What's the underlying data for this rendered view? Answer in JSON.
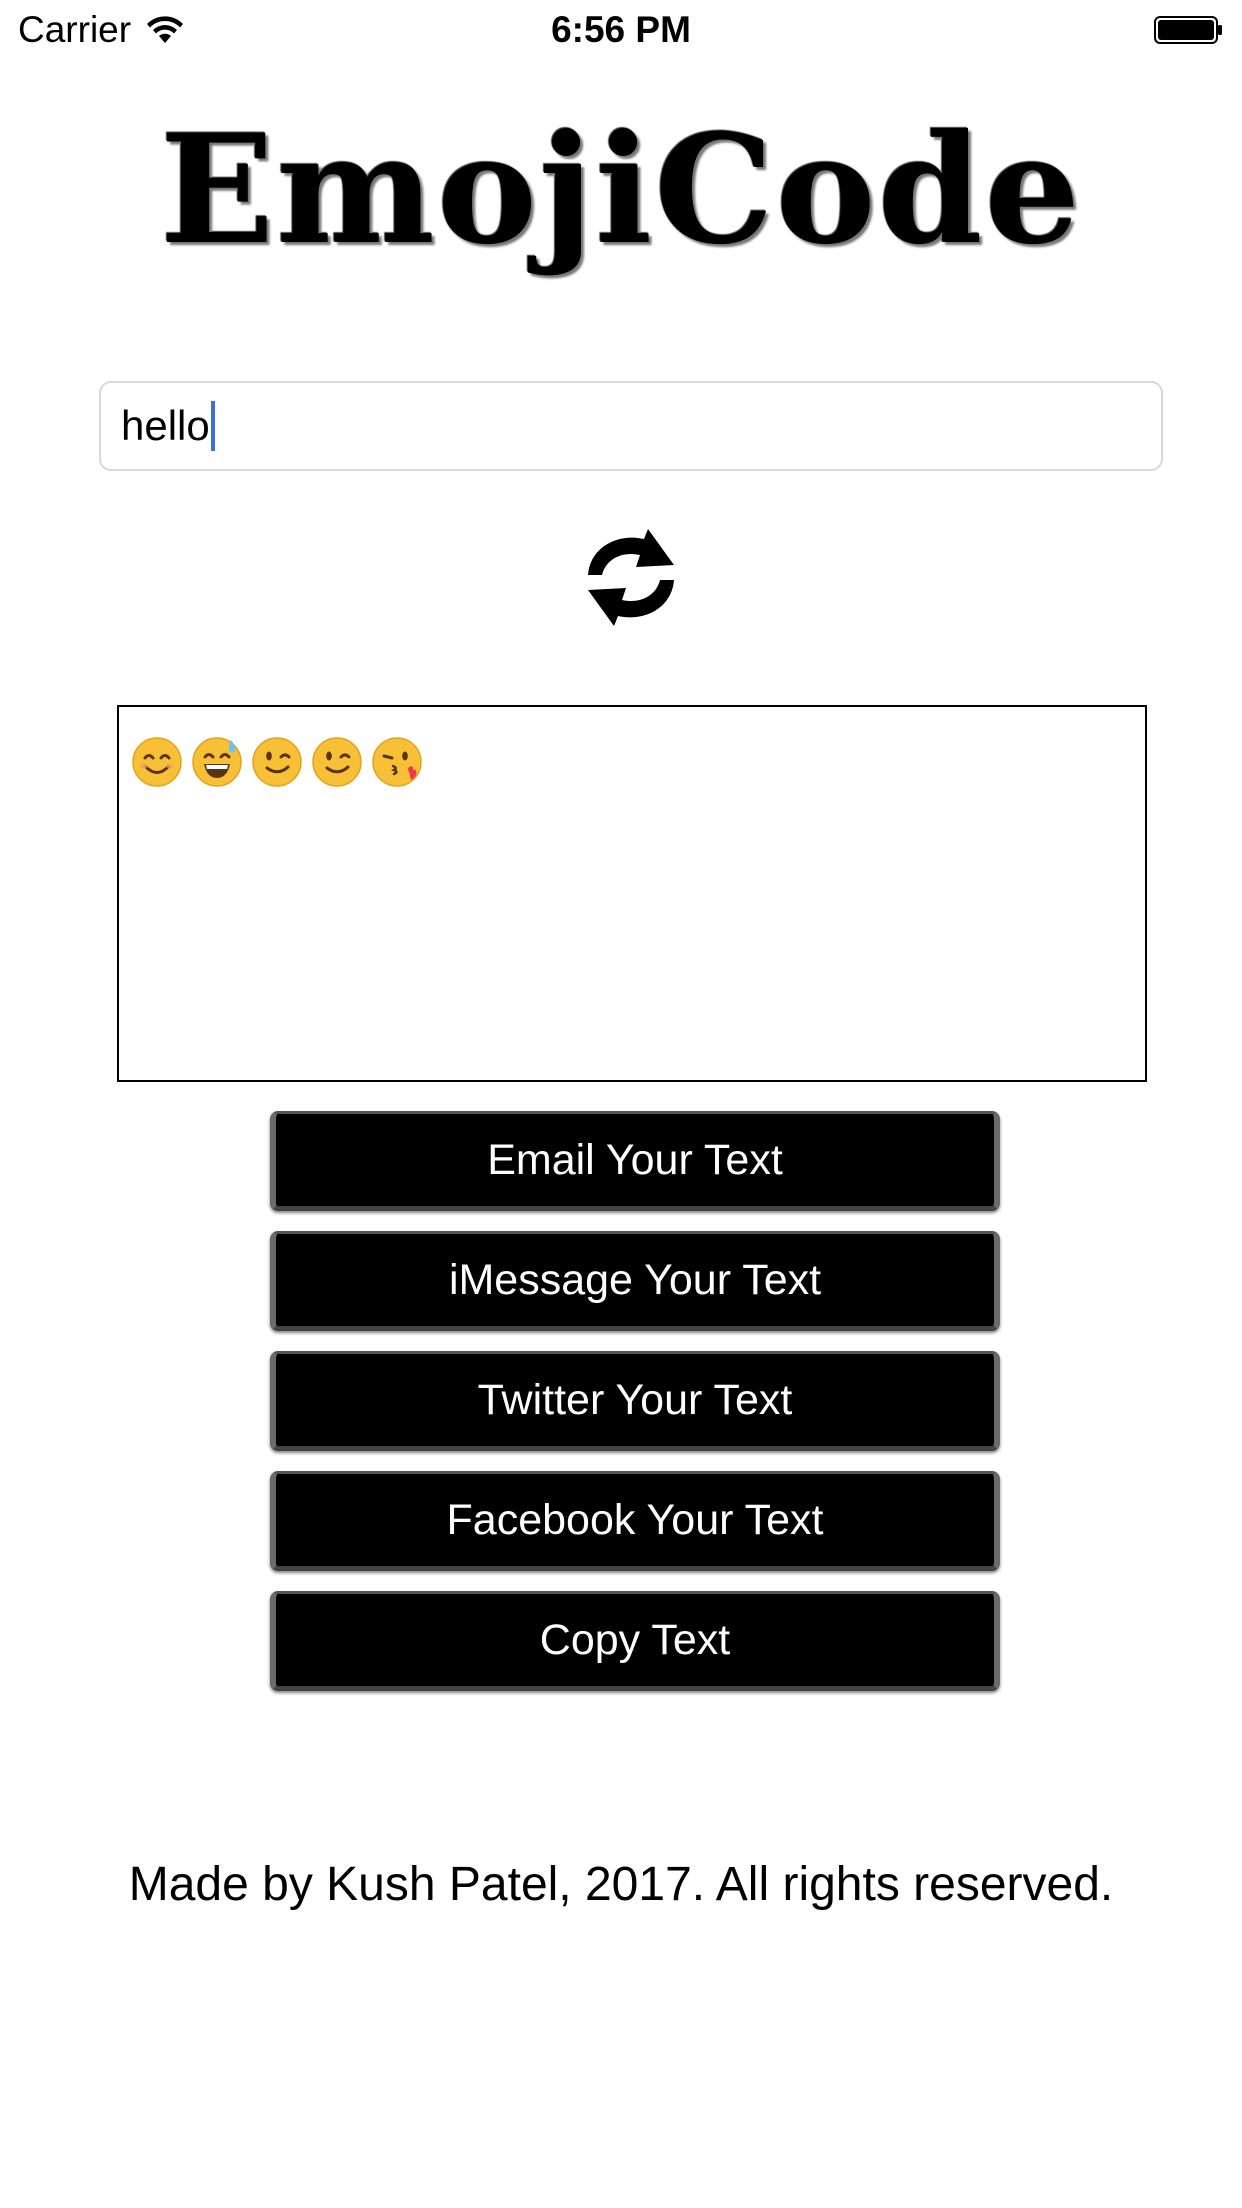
{
  "status_bar": {
    "carrier": "Carrier",
    "time": "6:56 PM",
    "wifi_icon": "wifi-icon",
    "battery_icon": "battery-full-icon"
  },
  "logo": {
    "text": "EmojiCode"
  },
  "input": {
    "value": "hello"
  },
  "convert": {
    "icon": "refresh-arrows-icon"
  },
  "output": {
    "emojis": [
      "smiling-face",
      "grinning-sweat-face",
      "winking-face",
      "winking-face",
      "face-blowing-kiss"
    ]
  },
  "buttons": {
    "email": "Email Your Text",
    "imessage": "iMessage Your Text",
    "twitter": "Twitter Your Text",
    "facebook": "Facebook Your Text",
    "copy": "Copy Text"
  },
  "footer": {
    "text": "Made by Kush Patel, 2017. All rights reserved."
  },
  "colors": {
    "background": "#ffffff",
    "button_bg": "#000000",
    "button_text": "#ffffff",
    "caret": "#3b6fd9"
  }
}
